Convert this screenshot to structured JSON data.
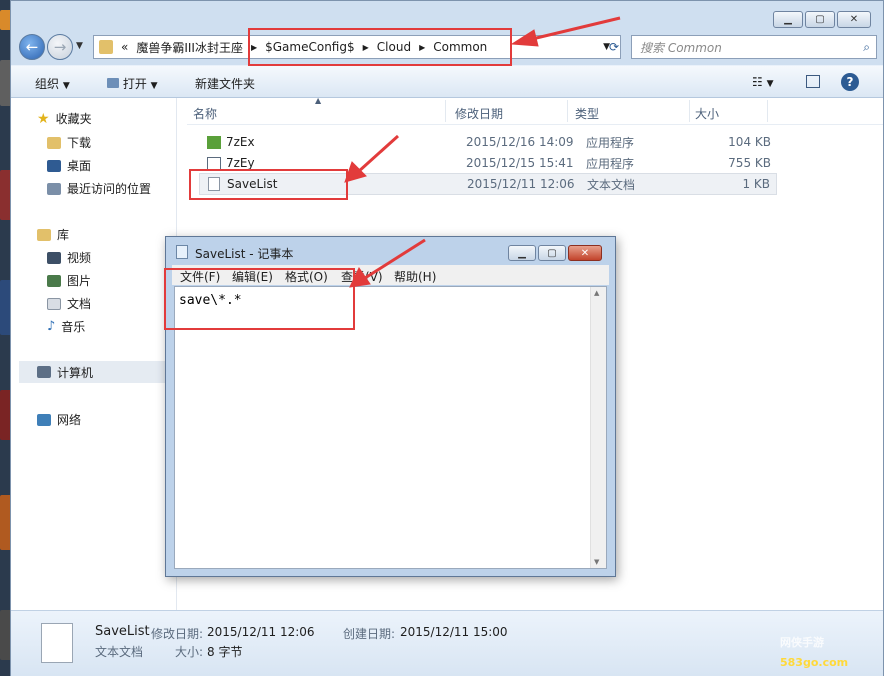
{
  "explorer": {
    "breadcrumb": {
      "overflow": "«",
      "parts": [
        "魔兽争霸III冰封王座",
        "$GameConfig$",
        "Cloud",
        "Common"
      ]
    },
    "search_placeholder": "搜索 Common",
    "toolbar": {
      "organize": "组织",
      "open": "打开",
      "new_folder": "新建文件夹"
    },
    "nav": {
      "favorites": "收藏夹",
      "downloads": "下载",
      "desktop": "桌面",
      "recent": "最近访问的位置",
      "libraries": "库",
      "videos": "视频",
      "pictures": "图片",
      "documents": "文档",
      "music": "音乐",
      "computer": "计算机",
      "network": "网络"
    },
    "columns": [
      "名称",
      "修改日期",
      "类型",
      "大小"
    ],
    "files": [
      {
        "name": "7zEx",
        "date": "2015/12/16 14:09",
        "type": "应用程序",
        "size": "104 KB"
      },
      {
        "name": "7zEy",
        "date": "2015/12/15 15:41",
        "type": "应用程序",
        "size": "755 KB"
      },
      {
        "name": "SaveList",
        "date": "2015/12/11 12:06",
        "type": "文本文档",
        "size": "1 KB"
      }
    ],
    "status": {
      "name": "SaveList",
      "mod_label": "修改日期:",
      "mod_value": "2015/12/11 12:06",
      "created_label": "创建日期:",
      "created_value": "2015/12/11 15:00",
      "type": "文本文档",
      "size_label": "大小:",
      "size_value": "8 字节"
    }
  },
  "notepad": {
    "title": "SaveList - 记事本",
    "menu": [
      "文件(F)",
      "编辑(E)",
      "格式(O)",
      "查看(V)",
      "帮助(H)"
    ],
    "content": "save\\*.*"
  },
  "watermark": {
    "site": "583go.com",
    "brand": "网侠手游"
  },
  "colors": {
    "annotation": "#e23b3b",
    "accent": "#2c5b93"
  }
}
